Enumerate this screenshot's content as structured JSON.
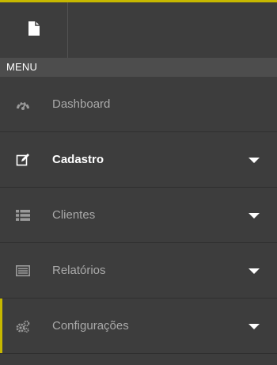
{
  "menu": {
    "header": "MENU",
    "items": [
      {
        "label": "Dashboard",
        "icon": "dashboard-icon",
        "has_caret": false
      },
      {
        "label": "Cadastro",
        "icon": "edit-icon",
        "has_caret": true
      },
      {
        "label": "Clientes",
        "icon": "list-icon",
        "has_caret": true
      },
      {
        "label": "Relatórios",
        "icon": "report-icon",
        "has_caret": true
      },
      {
        "label": "Configurações",
        "icon": "cogs-icon",
        "has_caret": true
      }
    ]
  },
  "colors": {
    "accent": "#c7b800",
    "background": "#3d3d3d",
    "header_background": "#4d4d4d",
    "muted_text": "#a9a9a9",
    "active_text": "#ffffff"
  }
}
